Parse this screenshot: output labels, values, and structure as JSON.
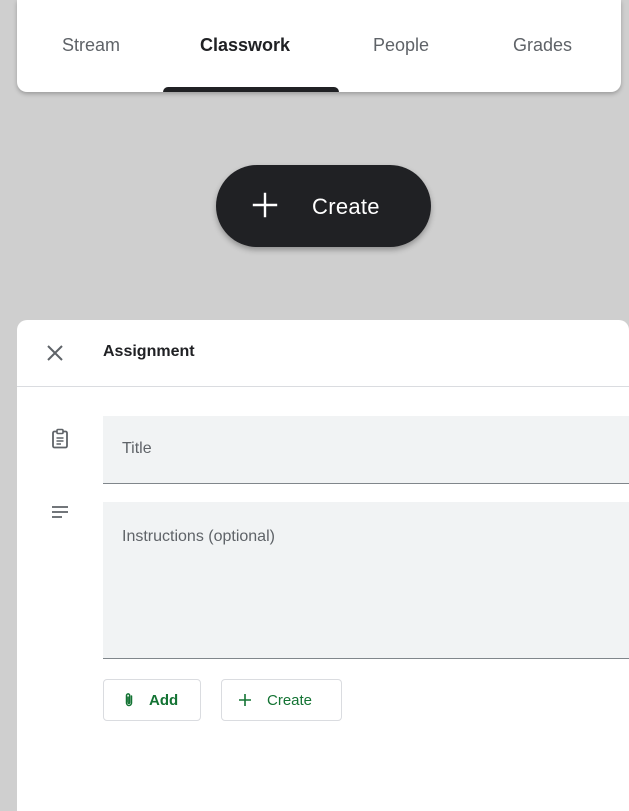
{
  "tabs": [
    {
      "label": "Stream"
    },
    {
      "label": "Classwork"
    },
    {
      "label": "People"
    },
    {
      "label": "Grades"
    }
  ],
  "active_tab": "Classwork",
  "create_fab": {
    "label": "Create",
    "icon": "plus-icon"
  },
  "dialog": {
    "title": "Assignment",
    "close_icon": "close-icon",
    "title_field": {
      "placeholder": "Title",
      "value": ""
    },
    "instructions_field": {
      "placeholder": "Instructions (optional)",
      "value": ""
    },
    "buttons": {
      "add": {
        "label": "Add",
        "icon": "paperclip-icon"
      },
      "create": {
        "label": "Create",
        "icon": "plus-icon"
      }
    }
  },
  "colors": {
    "background": "#cfcfcf",
    "dark": "#202124",
    "accent_green": "#137333",
    "field_bg": "#f1f3f4"
  }
}
